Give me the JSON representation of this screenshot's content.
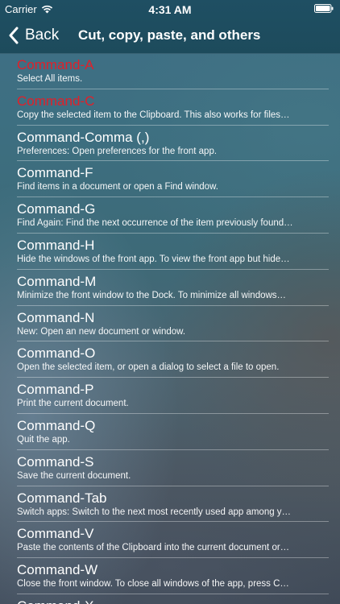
{
  "status_bar": {
    "carrier": "Carrier",
    "time": "4:31 AM",
    "icons": [
      "wifi-icon",
      "battery-icon"
    ]
  },
  "nav": {
    "back_label": "Back",
    "back_icon": "chevron-left-icon",
    "title": "Cut, copy, paste, and others"
  },
  "colors": {
    "accent_red": "#e0202a",
    "nav_bar": "#1f4f63",
    "text": "#ffffff"
  },
  "shortcuts": [
    {
      "key": "Command-A",
      "desc": "Select All items.",
      "highlighted": true
    },
    {
      "key": "Command-C",
      "desc": "Copy the selected item to the Clipboard. This also works for files…",
      "highlighted": true
    },
    {
      "key": "Command-Comma (,)",
      "desc": "Preferences: Open preferences for the front app.",
      "highlighted": false
    },
    {
      "key": "Command-F",
      "desc": "Find items in a document or open a Find window.",
      "highlighted": false
    },
    {
      "key": "Command-G",
      "desc": "Find Again: Find the next occurrence of the item previously found…",
      "highlighted": false
    },
    {
      "key": "Command-H",
      "desc": "Hide the windows of the front app. To view the front app but hide…",
      "highlighted": false
    },
    {
      "key": "Command-M",
      "desc": "Minimize the front window to the Dock. To minimize all windows…",
      "highlighted": false
    },
    {
      "key": "Command-N",
      "desc": "New: Open an new document or window.",
      "highlighted": false
    },
    {
      "key": "Command-O",
      "desc": "Open the selected item, or open a dialog to select a file to open.",
      "highlighted": false
    },
    {
      "key": "Command-P",
      "desc": "Print the current document.",
      "highlighted": false
    },
    {
      "key": "Command-Q",
      "desc": "Quit the app.",
      "highlighted": false
    },
    {
      "key": "Command-S",
      "desc": "Save the current document.",
      "highlighted": false
    },
    {
      "key": "Command-Tab",
      "desc": "Switch apps: Switch to the next most recently used app among y…",
      "highlighted": false
    },
    {
      "key": "Command-V",
      "desc": "Paste the contents of the Clipboard into the current document or…",
      "highlighted": false
    },
    {
      "key": "Command-W",
      "desc": "Close the front window. To close all windows of the app, press C…",
      "highlighted": false
    },
    {
      "key": "Command-X",
      "desc": "",
      "highlighted": false
    }
  ]
}
